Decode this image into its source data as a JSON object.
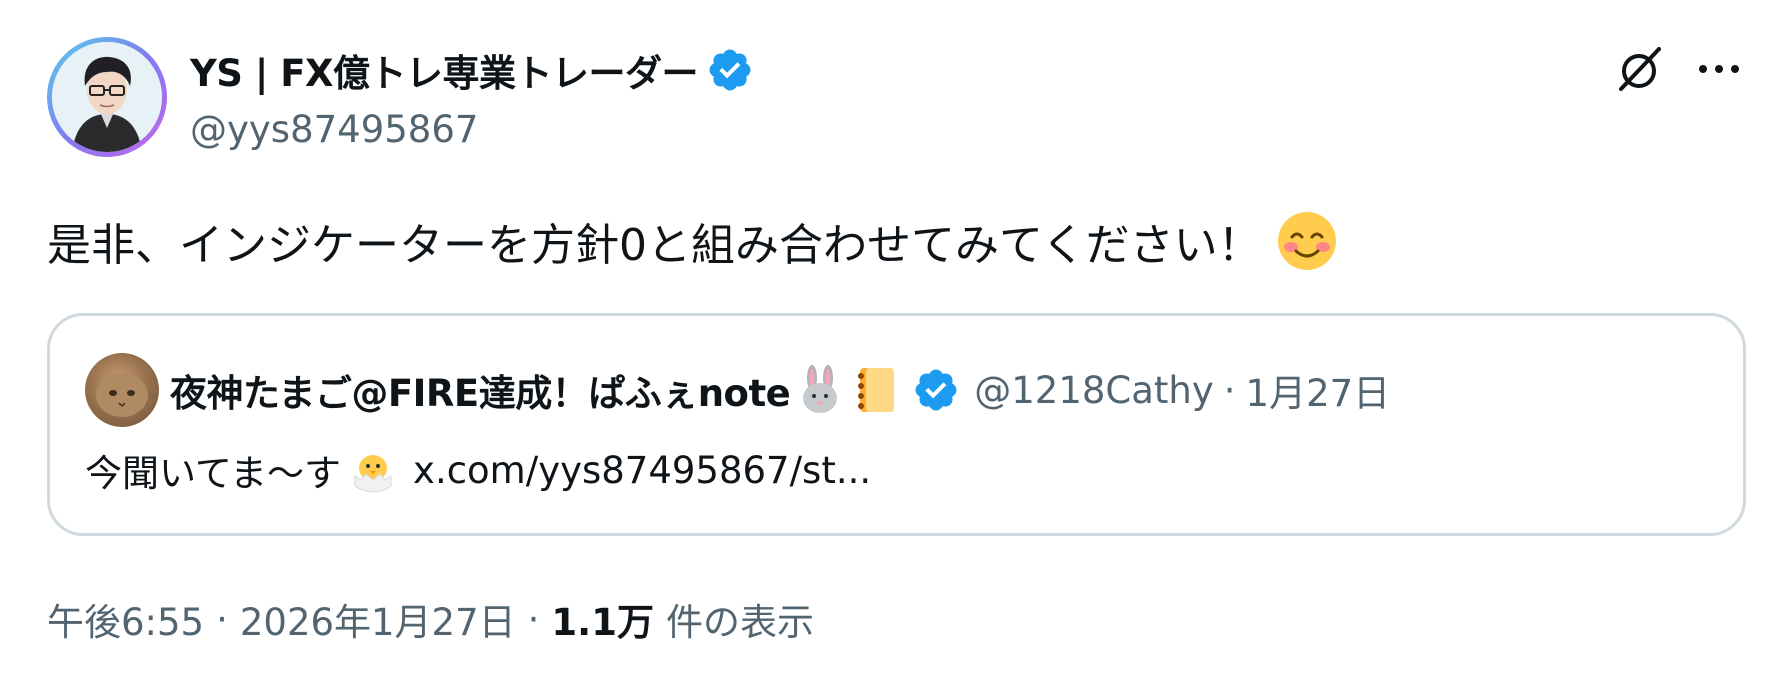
{
  "author": {
    "display_name": "YS | FX億トレ専業トレーダー",
    "handle": "@yys87495867",
    "verified_icon": "verified-badge-icon",
    "avatar": "avatar"
  },
  "actions": {
    "grok_icon": "grok-icon",
    "more_icon": "more-options-icon"
  },
  "tweet": {
    "text": "是非、インジケーターを方針0と組み合わせてみてください！",
    "emoji": "smiling-face-icon"
  },
  "quote": {
    "display_name": "夜神たまご@FIRE達成！ぱふぇnote",
    "emojis": [
      "rabbit-face-icon",
      "notebook-icon"
    ],
    "handle": "@1218Cathy",
    "separator": "·",
    "date": "1月27日",
    "text": "今聞いてま～す",
    "text_emoji": "hatching-chick-icon",
    "link": "x.com/yys87495867/st..."
  },
  "meta": {
    "time": "午後6:55",
    "separator": "·",
    "date": "2026年1月27日",
    "views_count": "1.1万",
    "views_label": "件の表示"
  },
  "colors": {
    "text_primary": "#0f1419",
    "text_secondary": "#536471",
    "verified_blue": "#1d9bf0",
    "border": "#cfd9de"
  }
}
